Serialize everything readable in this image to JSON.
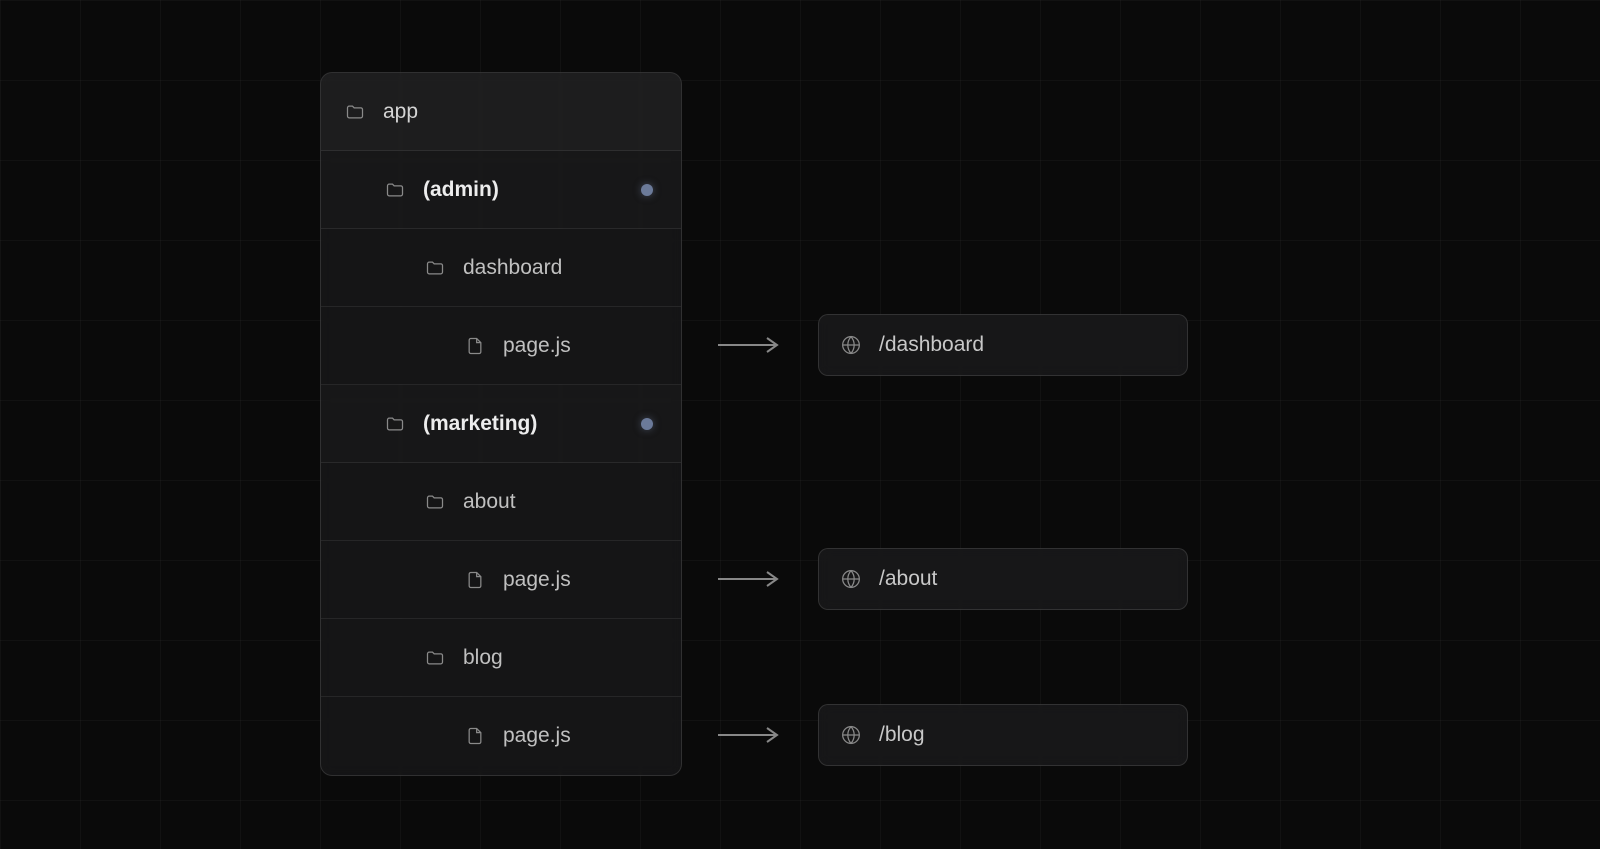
{
  "tree": {
    "root": "app",
    "rows": [
      {
        "kind": "group",
        "label": "(admin)",
        "dot": true
      },
      {
        "kind": "folder",
        "label": "dashboard"
      },
      {
        "kind": "file",
        "label": "page.js",
        "url_index": 0
      },
      {
        "kind": "group",
        "label": "(marketing)",
        "dot": true
      },
      {
        "kind": "folder",
        "label": "about"
      },
      {
        "kind": "file",
        "label": "page.js",
        "url_index": 1
      },
      {
        "kind": "folder",
        "label": "blog"
      },
      {
        "kind": "file",
        "label": "page.js",
        "url_index": 2
      }
    ]
  },
  "urls": [
    "/dashboard",
    "/about",
    "/blog"
  ]
}
